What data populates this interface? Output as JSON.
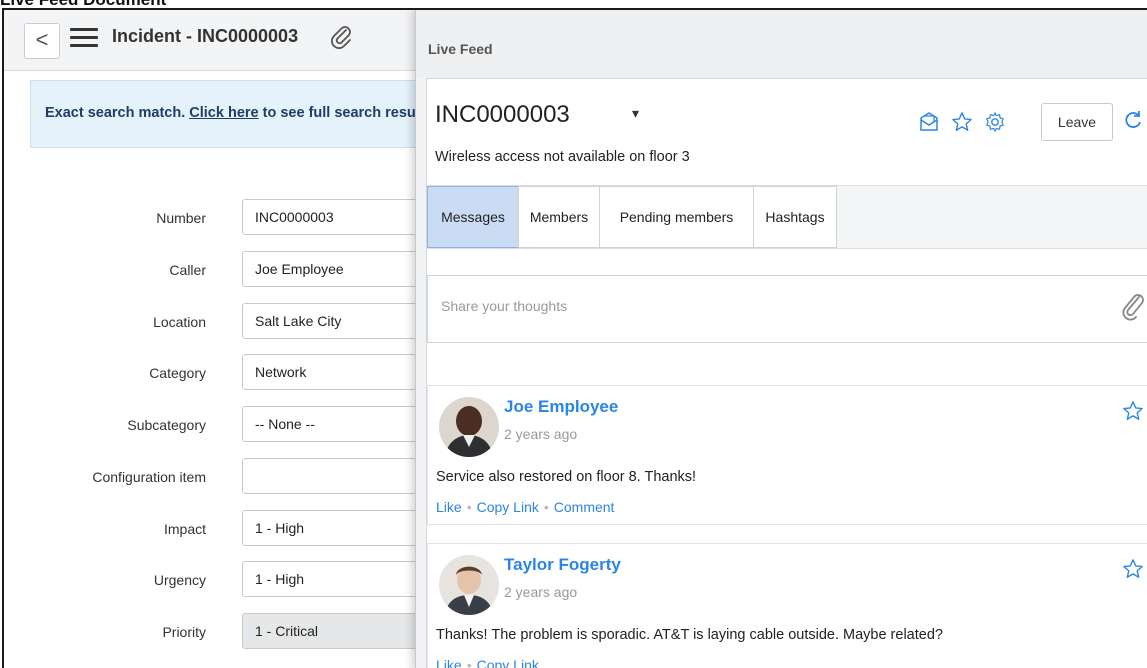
{
  "document_title": "Live Feed Document",
  "record": {
    "back_label": "<",
    "title": "Incident - INC0000003"
  },
  "banner": {
    "prefix": "Exact search match. ",
    "link": "Click here",
    "suffix": " to see full search results"
  },
  "form": {
    "fields": [
      {
        "label": "Number",
        "value": "INC0000003"
      },
      {
        "label": "Caller",
        "value": "Joe Employee"
      },
      {
        "label": "Location",
        "value": "Salt Lake City"
      },
      {
        "label": "Category",
        "value": "Network"
      },
      {
        "label": "Subcategory",
        "value": "-- None --"
      },
      {
        "label": "Configuration item",
        "value": ""
      },
      {
        "label": "Impact",
        "value": "1 - High"
      },
      {
        "label": "Urgency",
        "value": "1 - High"
      },
      {
        "label": "Priority",
        "value": "1 - Critical"
      }
    ]
  },
  "panel": {
    "title": "Live Feed",
    "conversation": {
      "title": "INC0000003",
      "caret": "▾",
      "subtitle": "Wireless access not available on floor 3",
      "leave_label": "Leave"
    },
    "tabs": [
      {
        "label": "Messages",
        "active": true
      },
      {
        "label": "Members",
        "active": false
      },
      {
        "label": "Pending members",
        "active": false
      },
      {
        "label": "Hashtags",
        "active": false
      }
    ],
    "share": {
      "placeholder": "Share your thoughts"
    },
    "posts": [
      {
        "author": "Joe Employee",
        "time": "2 years ago",
        "text": "Service also restored on floor 8. Thanks!",
        "actions": [
          "Like",
          "Copy Link",
          "Comment"
        ]
      },
      {
        "author": "Taylor Fogerty",
        "time": "2 years ago",
        "text": "Thanks! The problem is sporadic. AT&T is laying cable outside. Maybe related?",
        "actions": [
          "Like",
          "Copy Link"
        ]
      }
    ]
  },
  "colors": {
    "accent": "#2a85e5",
    "active_tab": "#c9dcf4",
    "banner": "#e5f1fb"
  }
}
